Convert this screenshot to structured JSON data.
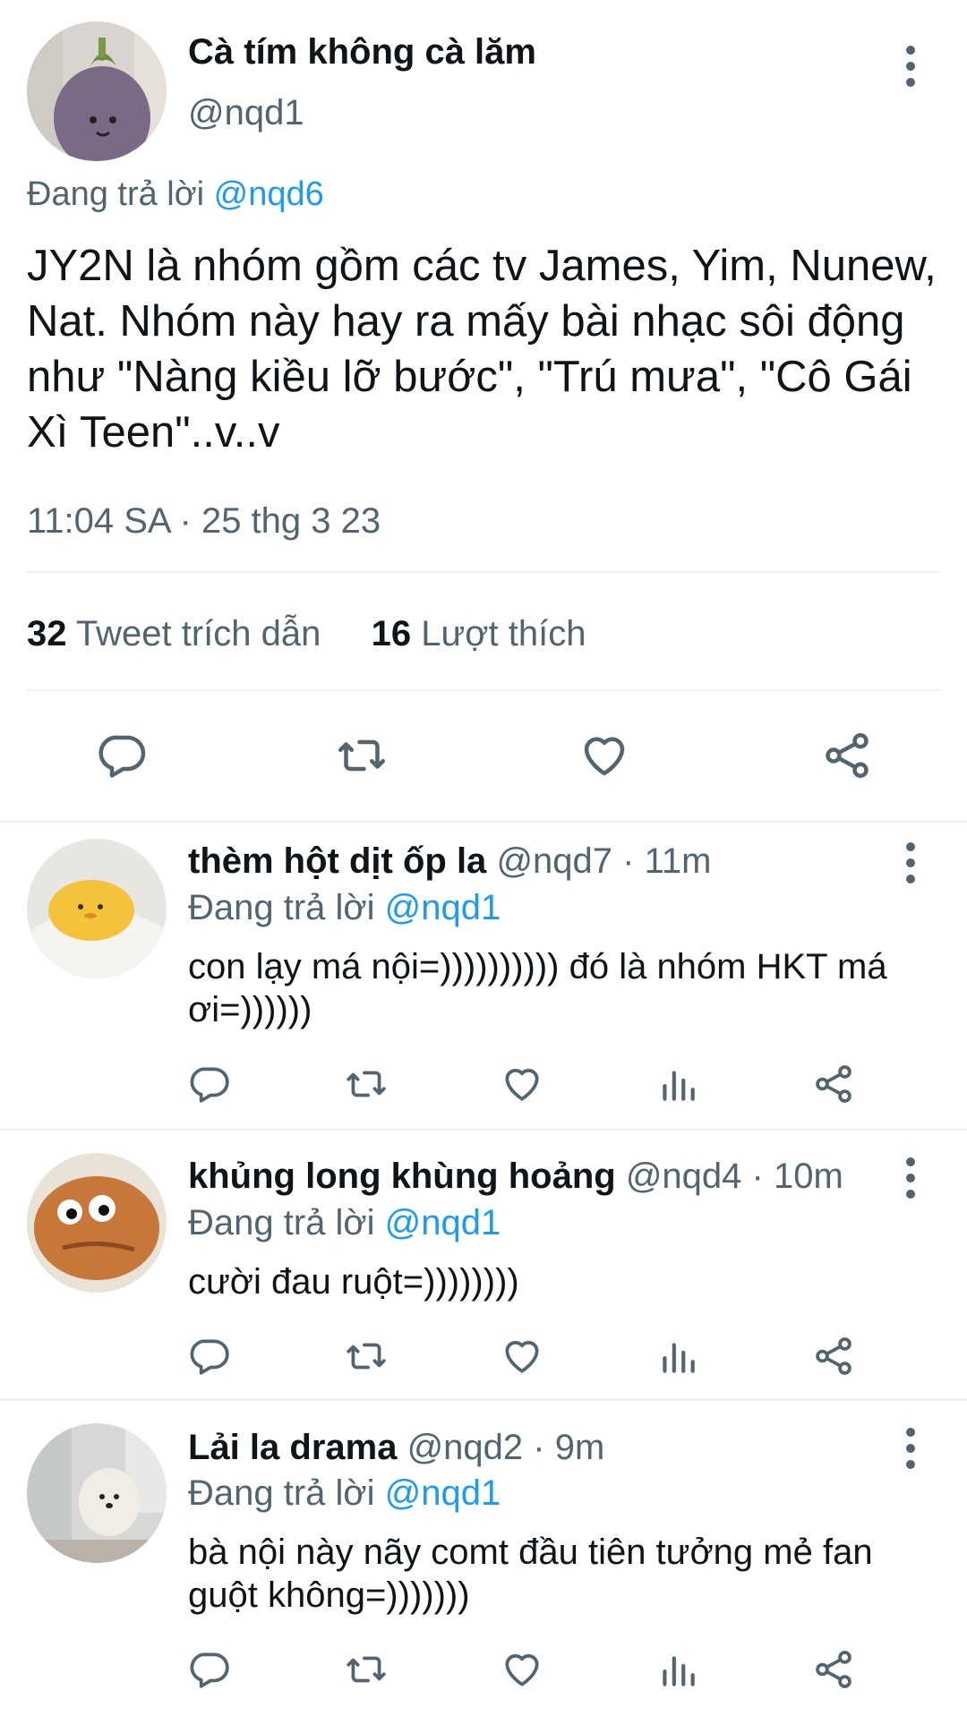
{
  "tweet": {
    "display_name": "Cà tím không cà lăm",
    "handle": "@nqd1",
    "replying_prefix": "Đang trả lời",
    "replying_to": "@nqd6",
    "text": "JY2N là nhóm gồm các tv James, Yim, Nunew, Nat. Nhóm này hay ra mấy bài nhạc sôi động như \"Nàng kiều lỡ bước\", \"Trú mưa\", \"Cô Gái Xì Teen\"..v..v",
    "timestamp": "11:04 SA · 25 thg 3 23",
    "quote_count": "32",
    "quote_label": "Tweet trích dẫn",
    "like_count": "16",
    "like_label": "Lượt thích"
  },
  "actions_icons": [
    "reply-icon",
    "retweet-icon",
    "like-icon",
    "share-icon"
  ],
  "reply_actions_icons": [
    "reply-icon",
    "retweet-icon",
    "like-icon",
    "views-icon",
    "share-icon"
  ],
  "replies": [
    {
      "display_name": "thèm hột dịt ốp la",
      "handle": "@nqd7",
      "time": "· 11m",
      "replying_prefix": "Đang trả lời",
      "replying_to": "@nqd1",
      "text": "con lạy má nội=)))))))))) đó là nhóm HKT má ơi=))))))"
    },
    {
      "display_name": "khủng long khùng hoảng",
      "handle": "@nqd4",
      "time": "· 10m",
      "replying_prefix": "Đang trả lời",
      "replying_to": "@nqd1",
      "text": "cười đau ruột=))))))))"
    },
    {
      "display_name": "Lải la drama",
      "handle": "@nqd2",
      "time": "· 9m",
      "replying_prefix": "Đang trả lời",
      "replying_to": "@nqd1",
      "text": "bà nội này nãy comt đầu tiên tưởng mẻ fan guột không=)))))))"
    }
  ],
  "colors": {
    "accent": "#1d9bf0",
    "secondary_text": "#536471",
    "divider": "#eff3f4"
  }
}
